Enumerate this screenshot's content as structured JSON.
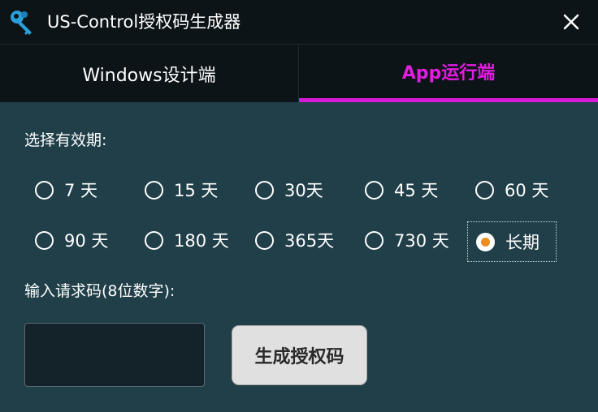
{
  "window": {
    "title": "US-Control授权码生成器",
    "icon": "key-icon",
    "close_icon": "close-icon"
  },
  "tabs": [
    {
      "label": "Windows设计端",
      "active": false
    },
    {
      "label": "App运行端",
      "active": true
    }
  ],
  "validity": {
    "label": "选择有效期:",
    "options": [
      {
        "label": "7 天",
        "checked": false
      },
      {
        "label": "15 天",
        "checked": false
      },
      {
        "label": "30天",
        "checked": false
      },
      {
        "label": "45 天",
        "checked": false
      },
      {
        "label": "60 天",
        "checked": false
      },
      {
        "label": "90 天",
        "checked": false
      },
      {
        "label": "180 天",
        "checked": false
      },
      {
        "label": "365天",
        "checked": false
      },
      {
        "label": "730 天",
        "checked": false
      },
      {
        "label": "长期",
        "checked": true
      }
    ]
  },
  "request_code": {
    "label": "输入请求码(8位数字):",
    "value": "",
    "placeholder": ""
  },
  "generate_button": {
    "label": "生成授权码"
  },
  "colors": {
    "background": "#203f49",
    "titlebar": "#0c1418",
    "accent": "#e21ce0",
    "radio_selected": "#ef8c1f"
  }
}
